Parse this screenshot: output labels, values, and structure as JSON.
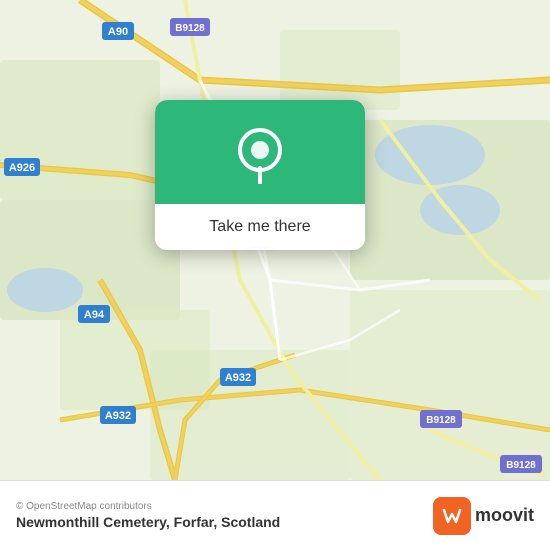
{
  "map": {
    "attribution": "© OpenStreetMap contributors",
    "alt": "Map showing Newmonthill Cemetery area near Forfar, Scotland"
  },
  "popup": {
    "button_label": "Take me there"
  },
  "bottom_bar": {
    "osm_credit": "© OpenStreetMap contributors",
    "location_title": "Newmonthill Cemetery, Forfar, Scotland",
    "moovit_label": "moovit"
  },
  "roads": {
    "a90_label": "A90",
    "b9128_label": "B9128",
    "a926_label": "A926",
    "a94_label": "A94",
    "a932_label": "A932"
  }
}
